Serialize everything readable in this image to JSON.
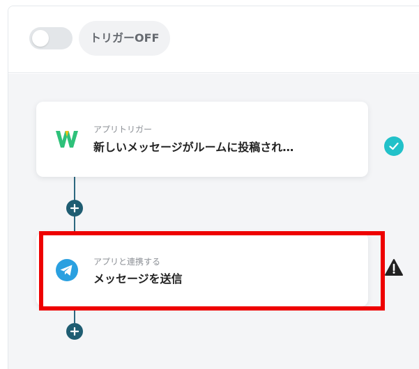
{
  "header": {
    "toggle_state": "off",
    "trigger_status_label": "トリガーOFF"
  },
  "flow": {
    "steps": [
      {
        "subtitle": "アプリトリガー",
        "title": "新しいメッセージがルームに投稿され…",
        "app_icon": "w-logo-icon",
        "status": "check-icon"
      },
      {
        "subtitle": "アプリと連携する",
        "title": "メッセージを送信",
        "app_icon": "telegram-icon",
        "status": "warning-icon"
      }
    ]
  },
  "colors": {
    "accent_teal": "#22c1c9",
    "connector": "#2c6880",
    "add_button": "#1f5d72",
    "highlight": "#ee0000",
    "w_logo_green": "#2ec17a",
    "telegram_blue": "#2aa0e0"
  }
}
